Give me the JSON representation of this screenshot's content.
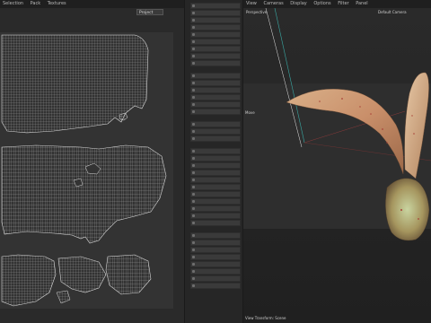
{
  "uv_editor": {
    "menu": [
      "Selection",
      "Pack",
      "Textures"
    ],
    "dropdown_value": "Project"
  },
  "viewport": {
    "menu": [
      "View",
      "Cameras",
      "Display",
      "Options",
      "Filter",
      "Panel"
    ],
    "view_label": "Perspective",
    "camera_label": "Default Camera",
    "move_label": "Move",
    "footer_label": "View Transform: Scene"
  },
  "tools": {
    "count": 37,
    "groups": [
      9,
      6,
      3,
      11,
      8
    ]
  }
}
